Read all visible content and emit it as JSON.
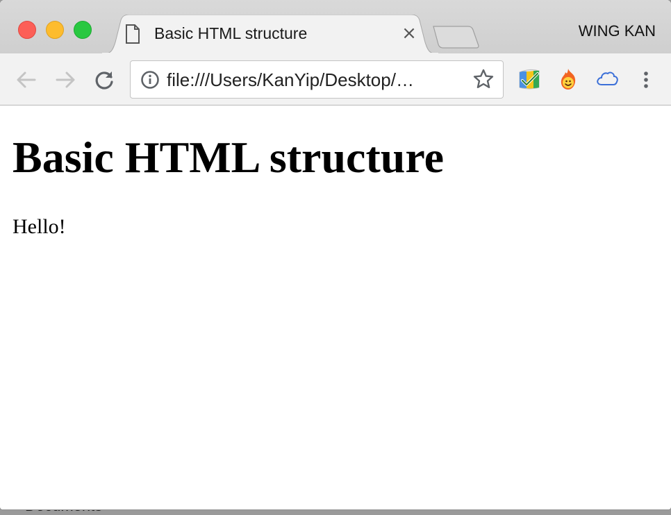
{
  "background": {
    "peek_text": "Documents"
  },
  "window": {
    "tab": {
      "title": "Basic HTML structure",
      "close_glyph": "×"
    },
    "profile_name": "WING KAN",
    "toolbar": {
      "url": "file:///Users/KanYip/Desktop/…",
      "icons": [
        "back-arrow-icon",
        "forward-arrow-icon",
        "reload-icon",
        "info-icon",
        "star-icon",
        "maps-extension-icon",
        "fire-extension-icon",
        "cloud-extension-icon",
        "more-menu-icon"
      ]
    }
  },
  "page": {
    "heading": "Basic HTML structure",
    "paragraph": "Hello!"
  },
  "colors": {
    "close": "#fc5f57",
    "minimize": "#fdbc2e",
    "maximize": "#28c840",
    "toolbar_bg": "#f2f2f2",
    "tabbar_bg": "#d4d4d4"
  }
}
